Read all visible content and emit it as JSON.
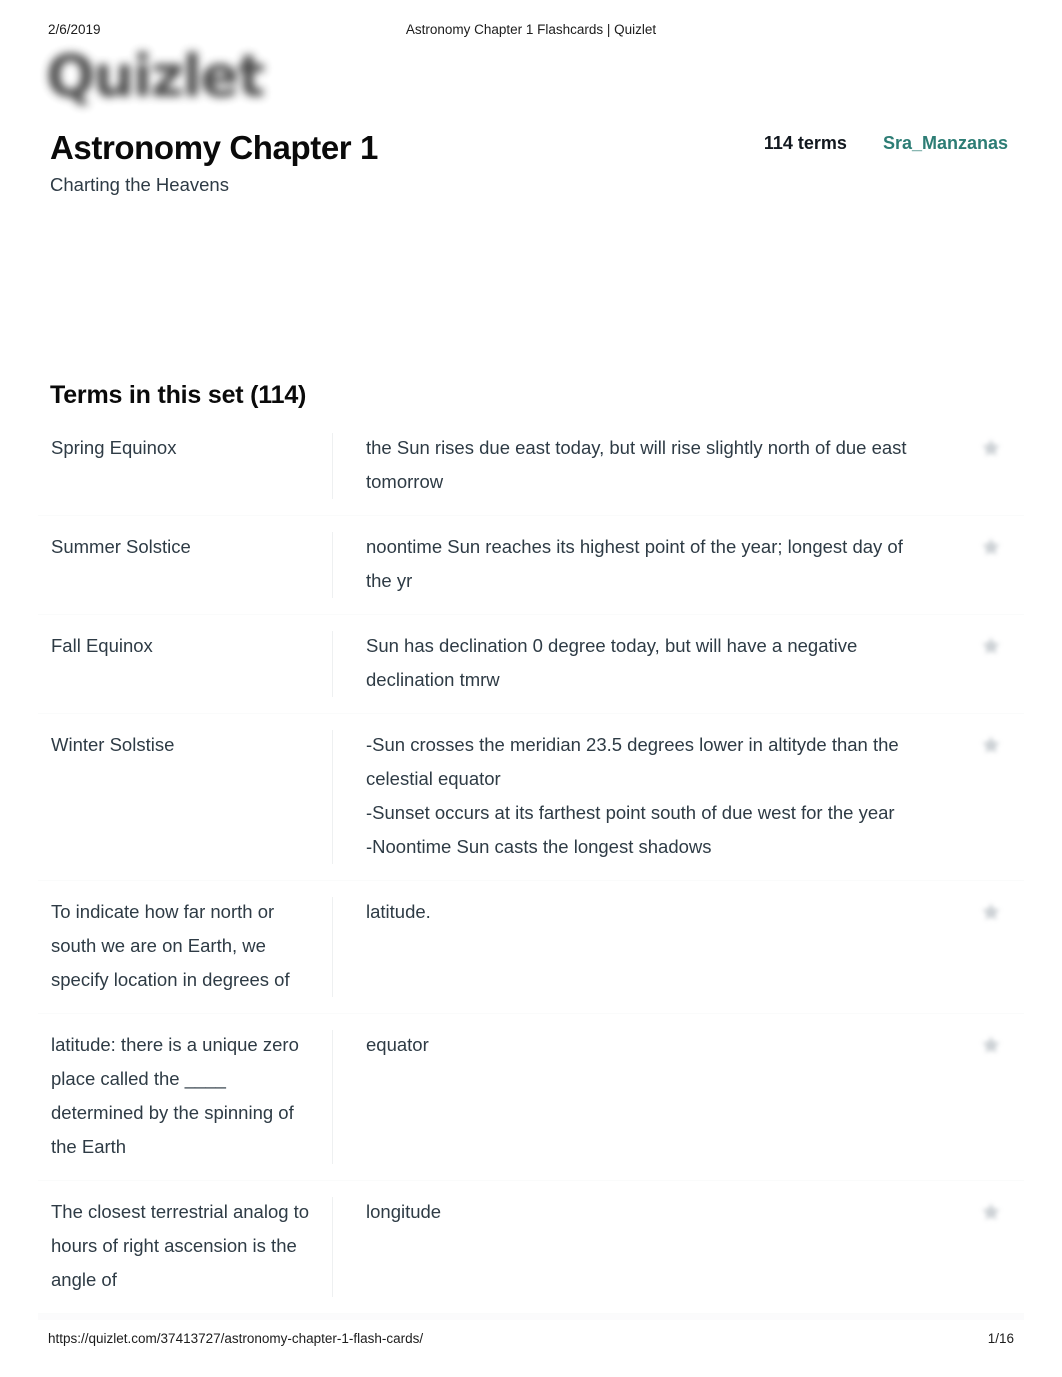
{
  "print_header": {
    "date": "2/6/2019",
    "document_title": "Astronomy Chapter 1 Flashcards | Quizlet"
  },
  "brand": {
    "logo_text": "Quizlet",
    "logo_icon": "quizlet-wordmark"
  },
  "set_header": {
    "title": "Astronomy Chapter 1",
    "subtitle": "Charting the Heavens",
    "terms_count_label": "114 terms",
    "author": "Sra_Manzanas",
    "accent_color": "#2d7d75"
  },
  "terms_section": {
    "heading": "Terms in this set (114)",
    "star_icon": "star-icon",
    "rows": [
      {
        "term": "Spring Equinox",
        "definition": "the Sun rises due east today, but will rise slightly north of due east tomorrow"
      },
      {
        "term": "Summer Solstice",
        "definition": "noontime Sun reaches its highest point of the year; longest day of the yr"
      },
      {
        "term": "Fall Equinox",
        "definition": "Sun has declination 0 degree today, but will have a negative declination tmrw"
      },
      {
        "term": "Winter Solstise",
        "definition": "-Sun crosses the meridian 23.5 degrees lower in altityde than the celestial equator\n-Sunset occurs at its farthest point south of due west for the year\n-Noontime Sun casts the longest shadows"
      },
      {
        "term": "To indicate how far north or south we are on Earth, we specify location in degrees of",
        "definition": "latitude."
      },
      {
        "term": "latitude: there is a unique zero place called the ____ determined by the spinning of the Earth",
        "definition": "equator"
      },
      {
        "term": "The closest terrestrial analog to hours of right ascension is the angle of",
        "definition": "longitude"
      }
    ]
  },
  "print_footer": {
    "url": "https://quizlet.com/37413727/astronomy-chapter-1-flash-cards/",
    "page": "1/16"
  }
}
